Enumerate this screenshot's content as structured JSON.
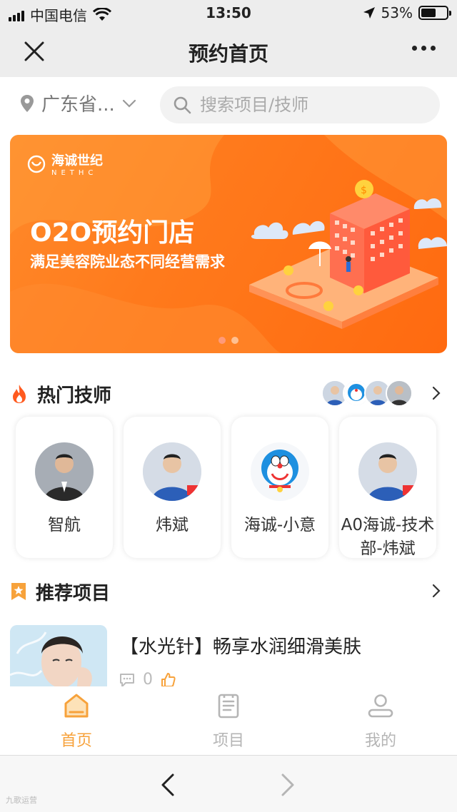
{
  "status_bar": {
    "carrier": "中国电信",
    "time": "13:50",
    "battery": "53%",
    "battery_level": 0.53
  },
  "nav": {
    "title": "预约首页"
  },
  "location": {
    "text": "广东省..."
  },
  "search": {
    "placeholder": "搜索项目/技师"
  },
  "banner": {
    "logo_cn": "海诚世纪",
    "logo_en": "NETHC",
    "headline": "O2O预约门店",
    "subtitle": "满足美容院业态不同经营需求",
    "dot_count": 2,
    "active_dot": 0
  },
  "hot_techs": {
    "label": "热门技师",
    "items": [
      {
        "name": "智航",
        "avatar": "man-in-suit"
      },
      {
        "name": "炜斌",
        "avatar": "man-blue-suit"
      },
      {
        "name": "海诚-小意",
        "avatar": "doraemon"
      },
      {
        "name": "A0海诚-技术部-炜斌",
        "avatar": "man-blue-suit"
      }
    ]
  },
  "recommend": {
    "label": "推荐项目",
    "items": [
      {
        "title": "【水光针】畅享水润细滑美肤",
        "comments": "0"
      }
    ]
  },
  "tabbar": {
    "tabs": [
      {
        "label": "首页",
        "active": true
      },
      {
        "label": "项目",
        "active": false
      },
      {
        "label": "我的",
        "active": false
      }
    ],
    "active_color": "#f7a23b",
    "inactive_color": "#b5b5b5"
  },
  "browser": {
    "watermark": "九歌运营"
  },
  "colors": {
    "accent": "#ff7a1c",
    "star_orange": "#f7a23b"
  }
}
